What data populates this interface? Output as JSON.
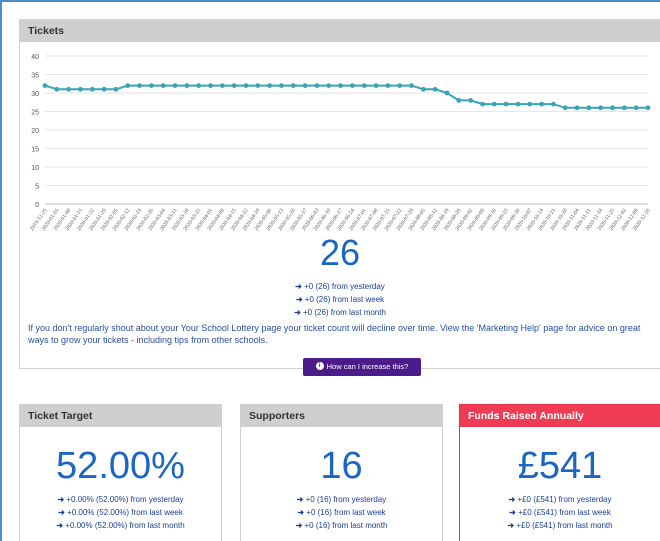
{
  "tickets": {
    "header": "Tickets",
    "count": "26",
    "changes": {
      "yesterday": "+0 (26) from yesterday",
      "week": "+0 (26) from last week",
      "month": "+0 (26) from last month"
    },
    "description": "If you don't regularly shout about your Your School Lottery page your ticket count will decline over time. View the 'Marketing Help' page for advice on great ways to grow your tickets - including tips from other schools.",
    "help_button": "How can I increase this?"
  },
  "ticket_target": {
    "header": "Ticket Target",
    "value": "52.00%",
    "changes": {
      "yesterday": "+0.00% (52.00%) from yesterday",
      "week": "+0.00% (52.00%) from last week",
      "month": "+0.00% (52.00%) from last month"
    }
  },
  "supporters": {
    "header": "Supporters",
    "value": "16",
    "changes": {
      "yesterday": "+0 (16) from yesterday",
      "week": "+0 (16) from last week",
      "month": "+0 (16) from last month"
    }
  },
  "funds": {
    "header": "Funds Raised Annually",
    "value": "£541",
    "changes": {
      "yesterday": "+£0 (£541) from yesterday",
      "week": "+£0 (£541) from last week",
      "month": "+£0 (£541) from last month"
    }
  },
  "colors": {
    "line": "#3aa3b5",
    "accent_blue": "#1b66c4",
    "button_purple": "#4b1b8a",
    "funds_red": "#ef3b54"
  },
  "chart_data": {
    "type": "line",
    "title": "",
    "xlabel": "",
    "ylabel": "",
    "ylim": [
      0,
      40
    ],
    "yticks": [
      0,
      5,
      10,
      15,
      20,
      25,
      30,
      35,
      40
    ],
    "grid": true,
    "x": [
      "2019-12-25",
      "2020-01-01",
      "2020-01-08",
      "2020-01-15",
      "2020-01-22",
      "2020-01-29",
      "2020-02-05",
      "2020-02-12",
      "2020-02-19",
      "2020-02-26",
      "2020-03-04",
      "2020-03-11",
      "2020-03-18",
      "2020-03-25",
      "2020-04-01",
      "2020-04-08",
      "2020-04-15",
      "2020-04-22",
      "2020-04-29",
      "2020-05-06",
      "2020-05-13",
      "2020-05-20",
      "2020-05-27",
      "2020-06-03",
      "2020-06-10",
      "2020-06-17",
      "2020-06-24",
      "2020-07-01",
      "2020-07-08",
      "2020-07-15",
      "2020-07-22",
      "2020-07-29",
      "2020-08-05",
      "2020-08-12",
      "2020-08-19",
      "2020-08-26",
      "2020-09-02",
      "2020-09-09",
      "2020-09-16",
      "2020-09-23",
      "2020-09-30",
      "2020-10-07",
      "2020-10-14",
      "2020-10-21",
      "2020-10-28",
      "2020-11-04",
      "2020-11-11",
      "2020-11-18",
      "2020-11-25",
      "2020-12-02",
      "2020-12-09",
      "2020-12-16"
    ],
    "series": [
      {
        "values": [
          32,
          31,
          31,
          31,
          31,
          31,
          31,
          32,
          32,
          32,
          32,
          32,
          32,
          32,
          32,
          32,
          32,
          32,
          32,
          32,
          32,
          32,
          32,
          32,
          32,
          32,
          32,
          32,
          32,
          32,
          32,
          32,
          31,
          31,
          30,
          28,
          28,
          27,
          27,
          27,
          27,
          27,
          27,
          27,
          26,
          26,
          26,
          26,
          26,
          26,
          26,
          26
        ]
      }
    ]
  }
}
